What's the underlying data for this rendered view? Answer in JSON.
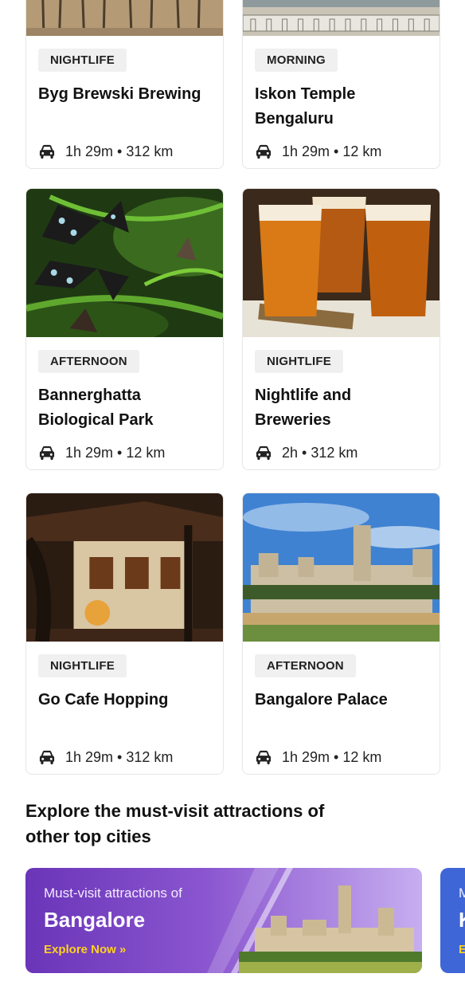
{
  "cards": [
    {
      "tag": "NIGHTLIFE",
      "title": "Byg Brewski Brewing",
      "meta": "1h 29m • 312 km",
      "image": "tree-canopy-photo"
    },
    {
      "tag": "MORNING",
      "title": "Iskon Temple Bengaluru",
      "meta": "1h 29m • 12 km",
      "image": "temple-photo"
    },
    {
      "tag": "AFTERNOON",
      "title": "Bannerghatta Biological Park",
      "meta": "1h 29m • 12 km",
      "image": "butterflies-photo"
    },
    {
      "tag": "NIGHTLIFE",
      "title": "Nightlife and Breweries",
      "meta": "2h • 312 km",
      "image": "beer-glasses-photo"
    },
    {
      "tag": "NIGHTLIFE",
      "title": "Go Cafe Hopping",
      "meta": "1h 29m • 312 km",
      "image": "cafe-night-photo"
    },
    {
      "tag": "AFTERNOON",
      "title": "Bangalore Palace",
      "meta": "1h 29m • 12 km",
      "image": "palace-photo"
    }
  ],
  "section": {
    "title": "Explore the must-visit attractions of other top cities"
  },
  "banners": [
    {
      "subtitle": "Must-visit attractions of",
      "city": "Bangalore",
      "cta": "Explore Now »"
    },
    {
      "subtitle": "M",
      "city": "K",
      "cta": "E"
    }
  ],
  "colors": {
    "banner_purple": "#6a35b8",
    "banner_blue": "#3f66d6",
    "cta_yellow": "#ffd21f"
  },
  "icons": {
    "meta": "car-icon"
  }
}
